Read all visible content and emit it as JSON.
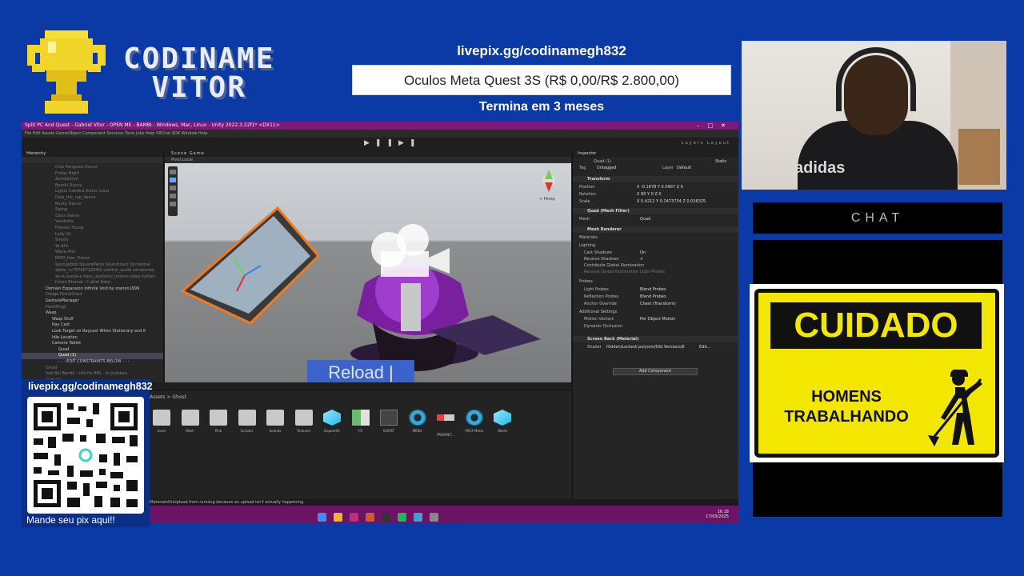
{
  "overlay": {
    "brand_line1": "CODINAME",
    "brand_line2": "VITOR",
    "goal_url": "livepix.gg/codinamegh832",
    "goal_title": "Oculos Meta Quest 3S (R$ 0,00/R$ 2.800,00)",
    "goal_ends": "Termina em 3 meses",
    "webcam_shirt_text": "adidas",
    "chat_label": "CHAT",
    "sign_title": "CUIDADO",
    "sign_line1": "HOMENS",
    "sign_line2": "TRABALHANDO",
    "qr_url": "livepix.gg/codinamegh832",
    "qr_caption": "Mande seu pix aqui!!"
  },
  "colors": {
    "background": "#0b3aa6",
    "titlebar": "#7b1a7a",
    "taskbar": "#6a1463",
    "sign_yellow": "#f3e600",
    "reload_blue": "#3b63c9"
  },
  "editor": {
    "title": "Split PC And Quest - Gabriel Vitor - OPEN ME - BAMBI - Windows, Mac, Linux - Unity 2022.3.22f1* <DX11>",
    "menu": "File  Edit  Assets  GameObject  Component  Services  Tools  Jobs  Help  VRChat SDK  Window  Help",
    "toolbar_right": "Layers    Layout",
    "hierarchy_title": "Hierarchy",
    "hierarchy_items": [
      {
        "label": "Club Penguins Dance",
        "bright": false
      },
      {
        "label": "Friday Night",
        "bright": false
      },
      {
        "label": "Zombietron",
        "bright": false
      },
      {
        "label": "Bambi Dance",
        "bright": false
      },
      {
        "label": "Lights Camera Action Loop",
        "bright": false
      },
      {
        "label": "Ovie_the_rap_dance",
        "bright": false
      },
      {
        "label": "Bucky Dance",
        "bright": false
      },
      {
        "label": "Swing",
        "bright": false
      },
      {
        "label": "Cacu Dance",
        "bright": false
      },
      {
        "label": "Vendetta",
        "bright": false
      },
      {
        "label": "Forever Young",
        "bright": false
      },
      {
        "label": "Lady Gt",
        "bright": false
      },
      {
        "label": "Smolly",
        "bright": false
      },
      {
        "label": "Ya Ahh",
        "bright": false
      },
      {
        "label": "Wave Ahh",
        "bright": false
      },
      {
        "label": "MMD_Hoe_Dance",
        "bright": false
      },
      {
        "label": "SpongeBob SquarePants Soundtrack Orchestral",
        "bright": false
      },
      {
        "label": "abbla_cc7876672294f3 cooltrix_audio conversion",
        "bright": false
      },
      {
        "label": "se-zu-kanjo-o-hasu_audiotrix (online-video-cutter)",
        "bright": false
      },
      {
        "label": "Doom Eternal - Cultist Base",
        "bright": false
      },
      {
        "label": "Domain Expansion Infinite Void by starlon1999",
        "bright": true
      },
      {
        "label": "Dodge PortalStack",
        "bright": false
      },
      {
        "label": "GestureManager",
        "bright": true
      },
      {
        "label": "FlashPingt",
        "bright": false
      },
      {
        "label": "Wasp",
        "bright": true
      },
      {
        "label": "Wasp Stuff",
        "bright": true
      },
      {
        "label": "Ray Cast",
        "bright": true
      },
      {
        "label": "Look Target on Raycast When Stationary and 6",
        "bright": true
      },
      {
        "label": "Idle Location",
        "bright": true
      },
      {
        "label": "Camera Tablet",
        "bright": true
      },
      {
        "label": "Quad",
        "bright": true
      },
      {
        "label": "Quad (1)",
        "bright": true,
        "selected": true
      },
      {
        "label": "- - - EDIT CONSTRAINTS BELOW - - -",
        "bright": true
      },
      {
        "label": "Ghost",
        "bright": false
      },
      {
        "label": "Sad Boi Bambi - Life.fm 8PS - tu pumbaa",
        "bright": false
      },
      {
        "label": "Camera",
        "bright": false
      }
    ],
    "scene_tabs": "Scene    Game",
    "scene_tools": "Pivot    Local",
    "persp_label": "< Persp",
    "reload_text": "Reload |",
    "inspector_title": "Inspector",
    "inspector_object": "Quad (1)",
    "inspector_static": "Static",
    "tag": "Untagged",
    "layer": "Default",
    "transform": "Transform",
    "position": "X -0.1878    Y 0.0907    Z 0",
    "rotation": "X 90    Y 0    Z 0",
    "scale": "X 0.4212    Y 0.2473734    Z 0.028325",
    "mesh_filter": "Quad (Mesh Filter)",
    "mesh_label": "Mesh",
    "mesh_value": "Quad",
    "mesh_renderer": "Mesh Renderer",
    "materials": "Materials",
    "lighting": "Lighting",
    "cast_shadows_label": "Cast Shadows",
    "cast_shadows_value": "On",
    "receive_shadows": "Receive Shadows",
    "contribute_gi": "Contribute Global Illumination",
    "receive_gi_label": "Receive Global Illumination",
    "receive_gi_value": "Light Probes",
    "probes": "Probes",
    "light_probes_label": "Light Probes",
    "light_probes_value": "Blend Probes",
    "reflection_probes_label": "Reflection Probes",
    "reflection_probes_value": "Blend Probes",
    "anchor_override_label": "Anchor Override",
    "anchor_override_value": "Chest (Transform)",
    "additional_settings": "Additional Settings",
    "motion_vectors_label": "Motion Vectors",
    "motion_vectors_value": "Per Object Motion",
    "dynamic_occlusion": "Dynamic Occlusion",
    "material_name": "Screen Back (Material)",
    "shader_label": "Shader",
    "shader_value": "Hidden/Locked/.poiyomi/Old Versions/8",
    "shader_edit": "Edit...",
    "add_component": "Add Component",
    "breadcrumb": "Assets > Ghost",
    "assets": [
      {
        "label": "Icons",
        "kind": "folder"
      },
      {
        "label": "Mesh",
        "kind": "folder"
      },
      {
        "label": "Pink",
        "kind": "folder"
      },
      {
        "label": "Scripter",
        "kind": "folder"
      },
      {
        "label": "Sounds",
        "kind": "folder"
      },
      {
        "label": "Textures",
        "kind": "folder"
      },
      {
        "label": "Dependnt",
        "kind": "cube"
      },
      {
        "label": "FX",
        "kind": "fx"
      },
      {
        "label": "GHOST",
        "kind": "ghost"
      },
      {
        "label": "MENU",
        "kind": "disc"
      },
      {
        "label": "PARAMET...",
        "kind": "param"
      },
      {
        "label": "VRCX Menu",
        "kind": "disc"
      },
      {
        "label": "World",
        "kind": "cube"
      }
    ],
    "status": "MaterialsOnUpload from running because an upload isn't actually happening",
    "tray_time": "16:18",
    "tray_date": "17/03/2025"
  }
}
